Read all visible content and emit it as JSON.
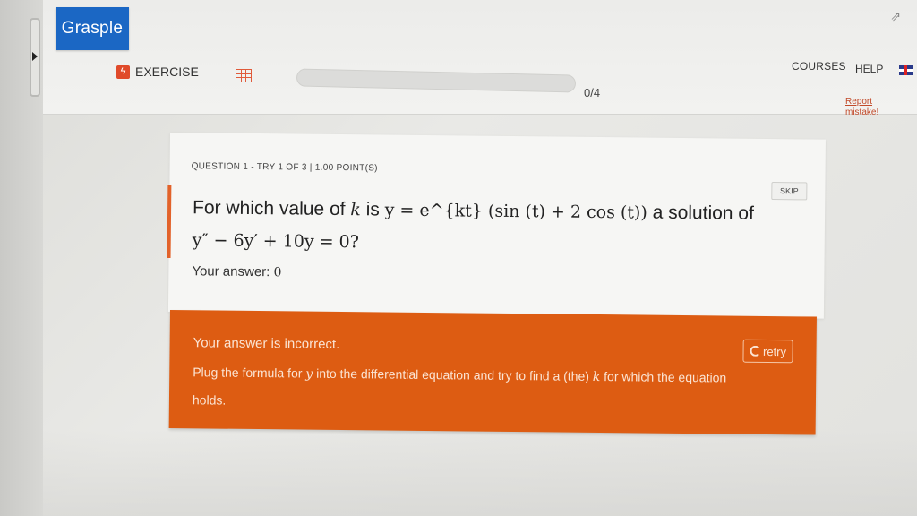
{
  "header": {
    "logo": "Grasple",
    "section_label": "EXERCISE",
    "progress_text": "0/4",
    "progress_fraction": 0,
    "nav": {
      "courses": "COURSES",
      "help": "HELP"
    },
    "report_mistake": "Report mistake!"
  },
  "question": {
    "meta": "QUESTION 1 - TRY 1 OF 3  | 1.00 POINT(S)",
    "skip_label": "SKIP",
    "text_prefix": "For which value of ",
    "text_var_k": "k",
    "text_is": " is ",
    "text_equation": "y = e^{kt} (sin (t) + 2 cos (t))",
    "text_middle": " a solution of ",
    "text_ode": "y″ − 6y′ + 10y = 0?",
    "answer_label": "Your answer: ",
    "answer_value": "0"
  },
  "feedback": {
    "title": "Your answer is incorrect.",
    "hint_prefix": "Plug the formula for ",
    "hint_var_y": "y",
    "hint_middle": " into the differential equation and try to find a (the) ",
    "hint_var_k": "k",
    "hint_suffix": " for which the equation holds.",
    "retry_label": "retry"
  },
  "colors": {
    "brand": "#1b67c4",
    "accent": "#dd5c12"
  }
}
